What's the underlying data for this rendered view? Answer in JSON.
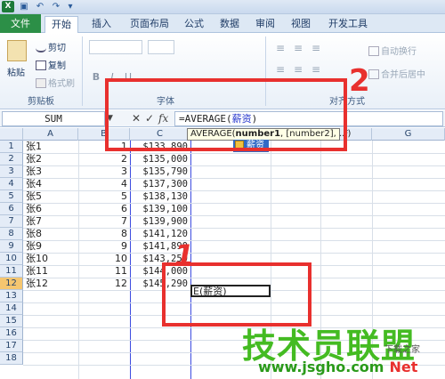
{
  "quick_access": {
    "app": "X",
    "save": "▣",
    "undo": "↶",
    "redo": "↷",
    "more": "▾"
  },
  "tabs": [
    "文件",
    "开始",
    "插入",
    "页面布局",
    "公式",
    "数据",
    "审阅",
    "视图",
    "开发工具"
  ],
  "ribbon": {
    "paste": "粘贴",
    "cut": "剪切",
    "copy": "复制",
    "format_painter": "格式刷",
    "clipboard_group": "剪贴板",
    "font_group": "字体",
    "align_group": "对齐方式",
    "wrap_text": "自动换行",
    "merge_center": "合并后居中",
    "format_buttons": [
      "B",
      "I",
      "U"
    ]
  },
  "formula_bar": {
    "name_box": "SUM",
    "cancel": "✕",
    "enter": "✓",
    "fx": "fx",
    "formula_prefix": "=AVERAGE(",
    "formula_ref": "薪资",
    "formula_suffix": ")"
  },
  "tooltip": {
    "fn": "AVERAGE(",
    "arg1": "number1",
    "rest": ", [number2], ...)"
  },
  "autocomplete": {
    "item": "薪资"
  },
  "columns": [
    "A",
    "B",
    "C",
    "D",
    "E",
    "F",
    "G"
  ],
  "rows": [
    {
      "n": "1",
      "name": "张1",
      "idx": "1",
      "pay": "$133,890"
    },
    {
      "n": "2",
      "name": "张2",
      "idx": "2",
      "pay": "$135,000"
    },
    {
      "n": "3",
      "name": "张3",
      "idx": "3",
      "pay": "$135,790"
    },
    {
      "n": "4",
      "name": "张4",
      "idx": "4",
      "pay": "$137,300"
    },
    {
      "n": "5",
      "name": "张5",
      "idx": "5",
      "pay": "$138,130"
    },
    {
      "n": "6",
      "name": "张6",
      "idx": "6",
      "pay": "$139,100"
    },
    {
      "n": "7",
      "name": "张7",
      "idx": "7",
      "pay": "$139,900"
    },
    {
      "n": "8",
      "name": "张8",
      "idx": "8",
      "pay": "$141,120"
    },
    {
      "n": "9",
      "name": "张9",
      "idx": "9",
      "pay": "$141,890"
    },
    {
      "n": "10",
      "name": "张10",
      "idx": "10",
      "pay": "$143,250"
    },
    {
      "n": "11",
      "name": "张11",
      "idx": "11",
      "pay": "$144,000"
    },
    {
      "n": "12",
      "name": "张12",
      "idx": "12",
      "pay": "$145,290"
    },
    {
      "n": "13",
      "name": "",
      "idx": "",
      "pay": ""
    },
    {
      "n": "14",
      "name": "",
      "idx": "",
      "pay": ""
    },
    {
      "n": "15",
      "name": "",
      "idx": "",
      "pay": ""
    },
    {
      "n": "16",
      "name": "",
      "idx": "",
      "pay": ""
    },
    {
      "n": "17",
      "name": "",
      "idx": "",
      "pay": ""
    },
    {
      "n": "18",
      "name": "",
      "idx": "",
      "pay": ""
    }
  ],
  "active_cell_text": "E(薪资)",
  "annotations": {
    "label1": "1",
    "label2": "2"
  },
  "watermark": {
    "text": "技术员联盟",
    "url": "www.jsgho.com",
    "net": "Net",
    "corner": "下载之家"
  },
  "colors": {
    "annotation_red": "#e8302e",
    "watermark_green": "#44bb22",
    "file_tab": "#2c8f47",
    "ref_blue": "#2233cc"
  }
}
